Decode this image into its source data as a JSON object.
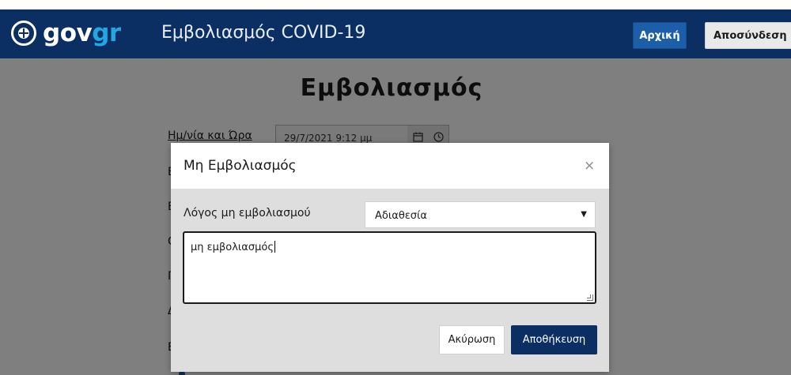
{
  "header": {
    "logo_gov": "gov",
    "logo_gr": "gr",
    "app_title": "Εμβολιασμός COVID-19",
    "home_button": "Αρχική",
    "logout_button": "Αποσύνδεση"
  },
  "page": {
    "title": "Εμβολιασμός",
    "datetime_label": "Ημ/νία και Ώρα",
    "datetime_value": "29/7/2021 9:12 μμ",
    "row_initials": [
      "Ε",
      "Ε",
      "Ο",
      "Γ",
      "Δ",
      "Ε"
    ]
  },
  "modal": {
    "title": "Μη Εμβολιασμός",
    "close_symbol": "×",
    "reason_label": "Λόγος μη εμβολιασμού",
    "reason_selected": "Αδιαθεσία",
    "note_value": "μη εμβολιασμός",
    "cancel_button": "Ακύρωση",
    "save_button": "Αποθήκευση"
  },
  "icons": {
    "calendar": "calendar-icon",
    "clock": "clock-icon",
    "dropdown": "chevron-down-icon"
  },
  "colors": {
    "navbar": "#0b2e63",
    "accent_gr": "#22a7e0",
    "home_button": "#1c5fa8",
    "save_button": "#0b2e63"
  }
}
